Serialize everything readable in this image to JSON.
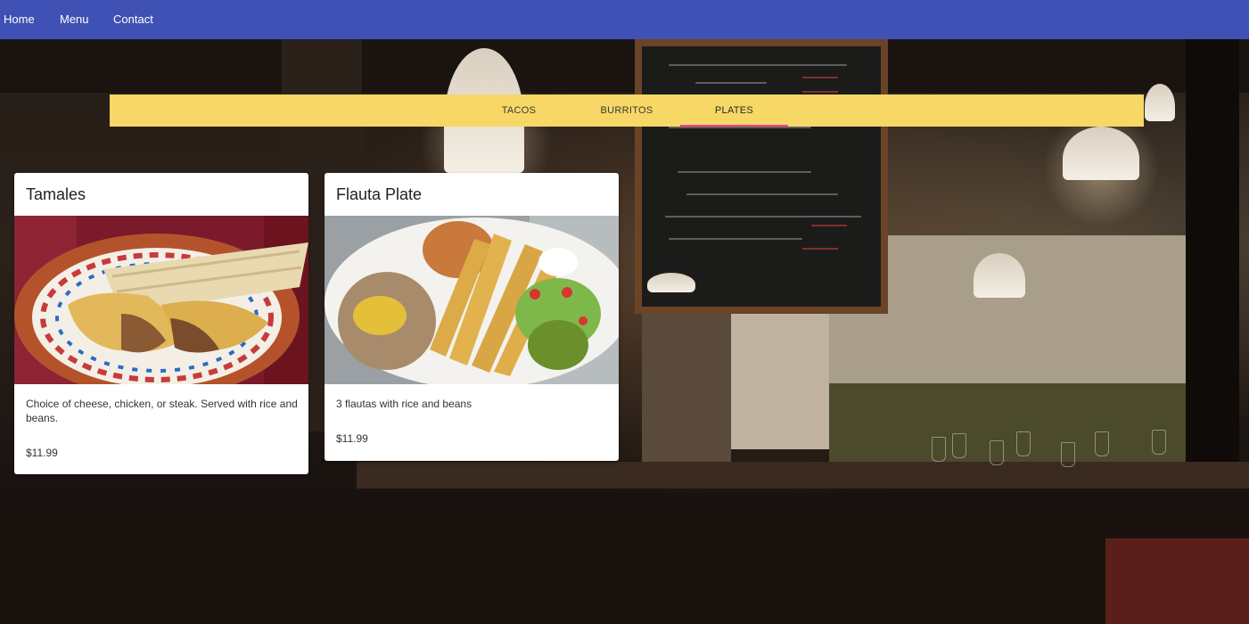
{
  "nav": {
    "home": "Home",
    "menu": "Menu",
    "contact": "Contact"
  },
  "tabs": [
    {
      "label": "TACOS"
    },
    {
      "label": "BURRITOS"
    },
    {
      "label": "PLATES",
      "active": true
    }
  ],
  "cards": [
    {
      "title": "Tamales",
      "image": "tamales-photo",
      "description": "Choice of cheese, chicken, or steak. Served with rice and beans.",
      "price": "$11.99"
    },
    {
      "title": "Flauta Plate",
      "image": "flauta-plate-photo",
      "description": "3 flautas with rice and beans",
      "price": "$11.99"
    }
  ],
  "colors": {
    "navbar": "#3f51b5",
    "tab_bar": "#f7d766",
    "tab_indicator": "#ff4081",
    "card_bg": "#ffffff"
  }
}
